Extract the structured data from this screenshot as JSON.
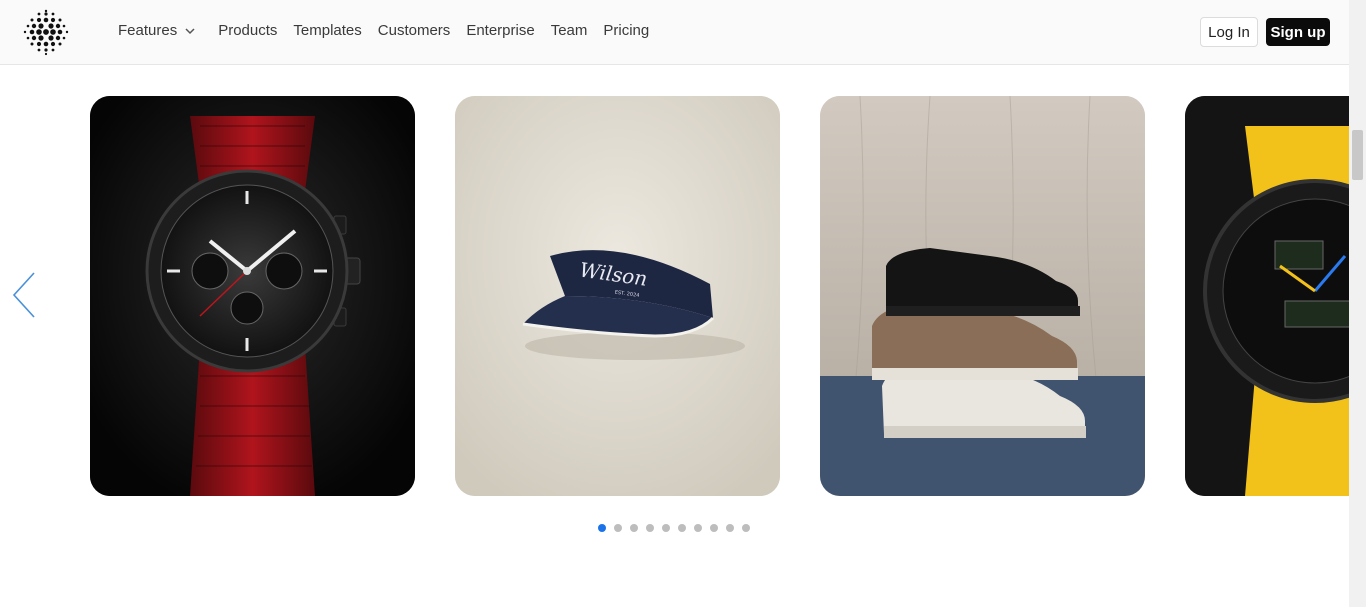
{
  "header": {
    "logo_icon": "dotted-sphere-logo",
    "nav": {
      "features": "Features",
      "products": "Products",
      "templates": "Templates",
      "customers": "Customers",
      "enterprise": "Enterprise",
      "team": "Team",
      "pricing": "Pricing"
    },
    "login_label": "Log In",
    "signup_label": "Sign up"
  },
  "carousel": {
    "prev_icon": "chevron-left-icon",
    "accent_color": "#1a73e8",
    "slides": [
      {
        "image": "black-chronograph-watch-red-strap"
      },
      {
        "image": "navy-visor-cap",
        "print_text": "Wilson",
        "sub_text": "EST. 2024"
      },
      {
        "image": "stacked-sneakers"
      },
      {
        "image": "yellow-strap-pilot-watch"
      }
    ],
    "dots_total": 10,
    "active_dot": 1
  }
}
